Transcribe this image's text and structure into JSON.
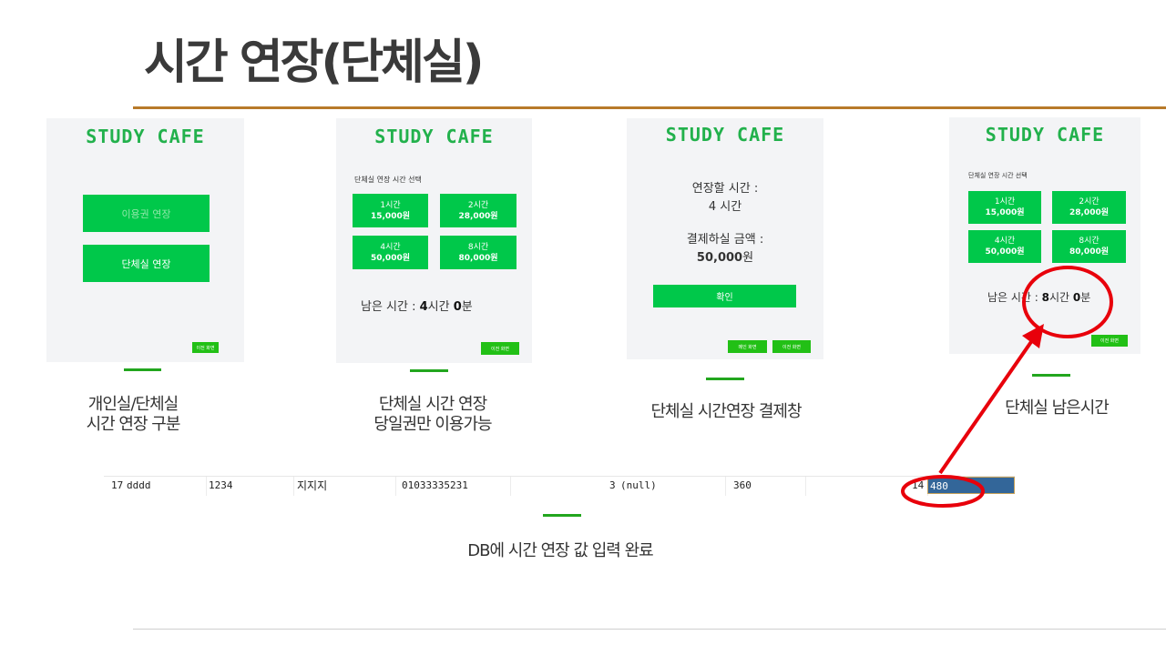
{
  "slide": {
    "title": "시간 연장(단체실)"
  },
  "logo_text": "STUDY CAFE",
  "screen1": {
    "personal_button": "이용권 연장",
    "group_button": "단체실 연장",
    "back_button": "이전 화면"
  },
  "screen2": {
    "section_label": "단체실 연장 시간 선택",
    "options": [
      {
        "time": "1시간",
        "price": "15,000원"
      },
      {
        "time": "2시간",
        "price": "28,000원"
      },
      {
        "time": "4시간",
        "price": "50,000원"
      },
      {
        "time": "8시간",
        "price": "80,000원"
      }
    ],
    "remaining_prefix": "남은 시간 : ",
    "remaining_hours": "4",
    "remaining_hours_unit": "시간 ",
    "remaining_minutes": "0",
    "remaining_minutes_unit": "분",
    "back_button": "이전 화면"
  },
  "screen3": {
    "extend_label": "연장할 시간 :",
    "extend_value": "4 시간",
    "amount_label": "결제하실 금액 :",
    "amount_number": "50,000",
    "amount_unit": "원",
    "confirm_button": "확인",
    "main_button": "메인 화면",
    "back_button": "이전 화면"
  },
  "screen4": {
    "section_label": "단체실 연장 시간 선택",
    "options": [
      {
        "time": "1시간",
        "price": "15,000원"
      },
      {
        "time": "2시간",
        "price": "28,000원"
      },
      {
        "time": "4시간",
        "price": "50,000원"
      },
      {
        "time": "8시간",
        "price": "80,000원"
      }
    ],
    "remaining_prefix": "남은 시간 : ",
    "remaining_hours": "8",
    "remaining_hours_unit": "시간 ",
    "remaining_minutes": "0",
    "remaining_minutes_unit": "분",
    "back_button": "이전 화면"
  },
  "captions": {
    "c1_line1": "개인실/단체실",
    "c1_line2": "시간 연장 구분",
    "c2_line1": "단체실 시간 연장",
    "c2_line2": "당일권만 이용가능",
    "c3": "단체실 시간연장 결제창",
    "c4": "단체실 남은시간",
    "db": "DB에 시간 연장 값 입력 완료"
  },
  "db_row": {
    "row_no": "17",
    "user_id": "dddd",
    "password": "1234",
    "name": "지지지",
    "phone": "01033335231",
    "room": "3",
    "nullval": "(null)",
    "time_before": "360",
    "seat": "14",
    "time_after": "480"
  },
  "colors": {
    "accent_line": "#b87a2a",
    "button_green": "#00c84a",
    "logo_green": "#22b14c",
    "highlight_red": "#e8000b",
    "db_selected": "#336699"
  }
}
